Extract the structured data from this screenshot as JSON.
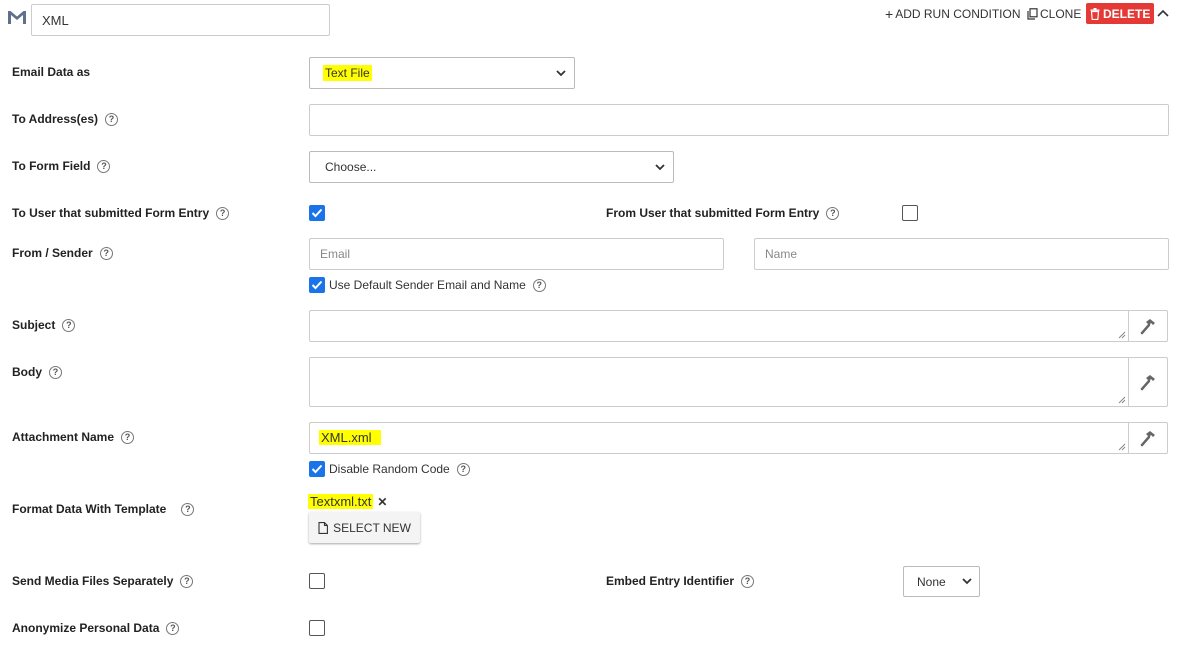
{
  "header": {
    "name_value": "XML",
    "add_run_condition": "ADD RUN CONDITION",
    "clone": "CLONE",
    "delete": "DELETE",
    "icons": {
      "brand": "gmail-icon",
      "add": "plus-icon",
      "clone": "copy-icon",
      "delete": "trash-icon",
      "collapse": "chevron-up-icon"
    }
  },
  "fields": {
    "email_data_as": {
      "label": "Email Data as",
      "value": "Text File"
    },
    "to_addresses": {
      "label": "To Address(es)",
      "value": ""
    },
    "to_form_field": {
      "label": "To Form Field",
      "value": "Choose..."
    },
    "to_user": {
      "label": "To User that submitted Form Entry",
      "checked": true
    },
    "from_user": {
      "label": "From User that submitted Form Entry",
      "checked": false
    },
    "from_sender": {
      "label": "From / Sender",
      "email_placeholder": "Email",
      "name_placeholder": "Name"
    },
    "use_default_sender": {
      "label": "Use Default Sender Email and Name",
      "checked": true
    },
    "subject": {
      "label": "Subject",
      "value": ""
    },
    "body": {
      "label": "Body",
      "value": ""
    },
    "attachment_name": {
      "label": "Attachment Name",
      "value": "XML.xml"
    },
    "disable_random_code": {
      "label": "Disable Random Code",
      "checked": true
    },
    "format_template": {
      "label": "Format Data With Template",
      "file": "Textxml.txt",
      "remove": "✕",
      "select_new": "SELECT NEW"
    },
    "send_media": {
      "label": "Send Media Files Separately",
      "checked": false
    },
    "embed_identifier": {
      "label": "Embed Entry Identifier",
      "value": "None"
    },
    "anonymize": {
      "label": "Anonymize Personal Data",
      "checked": false
    }
  },
  "help_glyph": "?",
  "colors": {
    "accent": "#1a73e8",
    "delete": "#e53935",
    "highlight": "#ffff00"
  }
}
